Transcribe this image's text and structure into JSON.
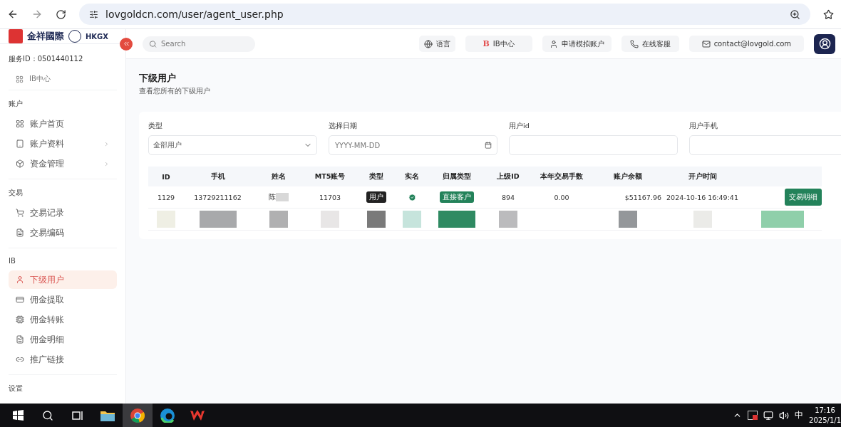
{
  "browser": {
    "url": "lovgoldcn.com/user/agent_user.php"
  },
  "brand": {
    "name": "金祥國際",
    "second": "HKGX"
  },
  "search": {
    "placeholder": "Search"
  },
  "header_buttons": [
    {
      "label": "语言"
    },
    {
      "label": "IB中心",
      "letter": "B"
    },
    {
      "label": "申请模拟账户"
    },
    {
      "label": "在线客服"
    },
    {
      "label": "contact@lovgold.com"
    }
  ],
  "sidebar": {
    "service_id": "服务ID：0501440112",
    "top_item": "IB中心",
    "sections": [
      {
        "title": "账户",
        "items": [
          {
            "label": "账户首页",
            "expandable": false,
            "selected": false
          },
          {
            "label": "账户资料",
            "expandable": true,
            "selected": false
          },
          {
            "label": "资金管理",
            "expandable": true,
            "selected": false
          }
        ]
      },
      {
        "title": "交易",
        "items": [
          {
            "label": "交易记录",
            "expandable": false,
            "selected": false
          },
          {
            "label": "交易编码",
            "expandable": false,
            "selected": false
          }
        ]
      },
      {
        "title": "IB",
        "items": [
          {
            "label": "下级用户",
            "expandable": false,
            "selected": true
          },
          {
            "label": "佣金提取",
            "expandable": false,
            "selected": false
          },
          {
            "label": "佣金转账",
            "expandable": false,
            "selected": false
          },
          {
            "label": "佣金明细",
            "expandable": false,
            "selected": false
          },
          {
            "label": "推广链接",
            "expandable": false,
            "selected": false
          }
        ]
      },
      {
        "title": "设置"
      }
    ]
  },
  "page": {
    "title": "下级用户",
    "subtitle": "查看您所有的下级用户"
  },
  "filters": [
    {
      "label": "类型",
      "kind": "select",
      "value": "全部用户"
    },
    {
      "label": "选择日期",
      "kind": "date",
      "placeholder": "YYYY-MM-DD"
    },
    {
      "label": "用户id",
      "kind": "text"
    },
    {
      "label": "用户手机",
      "kind": "text"
    }
  ],
  "table": {
    "columns": [
      "ID",
      "手机",
      "姓名",
      "MT5账号",
      "类型",
      "实名",
      "归属类型",
      "上级ID",
      "本年交易手数",
      "账户余额",
      "开户时间"
    ],
    "rows": [
      {
        "kind": "data",
        "id": "1129",
        "phone": "13729211162",
        "name": "陈",
        "name_redacted": true,
        "mt5": "11703",
        "type": "用户",
        "verified": true,
        "affiliation": "直接客户",
        "parent_id": "894",
        "lots": "0.00",
        "balance": "$51167.96",
        "opened": "2024-10-16 16:49:41",
        "action": "交易明细"
      },
      {
        "kind": "redacted"
      }
    ]
  },
  "taskbar": {
    "ime": "中",
    "time": "17:16",
    "date": "2025/1/1"
  }
}
